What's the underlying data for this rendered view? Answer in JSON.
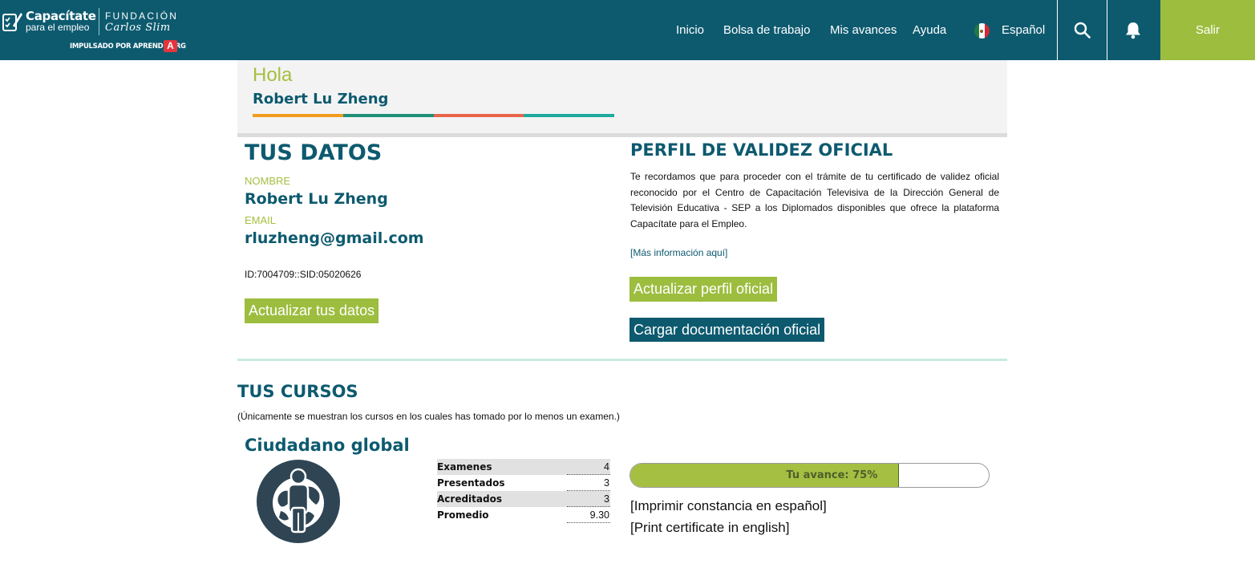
{
  "header": {
    "logo": {
      "brand": "Capacítate",
      "sub": "para el empleo",
      "fundacion": "FUNDACIÓN",
      "carlos_slim": "Carlos Slim",
      "impulsado": "IMPULSADO POR APRENDE.ORG",
      "a_badge": "A"
    },
    "nav": {
      "inicio": "Inicio",
      "bolsa": "Bolsa de trabajo",
      "avances": "Mis avances",
      "ayuda": "Ayuda",
      "language": "Español"
    },
    "salir": "Salir",
    "colors": {
      "bar": "#0d5a6f",
      "accent": "#9dbd3f"
    }
  },
  "greeting": {
    "hola": "Hola",
    "name": "Robert Lu Zheng",
    "bar_colors": [
      "#f39c1f",
      "#1f8f7a",
      "#e8664a",
      "#1eaaa0"
    ]
  },
  "tus_datos": {
    "title": "TUS DATOS",
    "nombre_label": "NOMBRE",
    "nombre": "Robert Lu Zheng",
    "email_label": "EMAIL",
    "email": "rluzheng@gmail.com",
    "id_text": "ID:7004709::SID:05020626",
    "update_button": "Actualizar tus datos"
  },
  "perfil": {
    "title": "PERFIL DE VALIDEZ OFICIAL",
    "paragraph": "Te recordamos que para proceder con el trámite de tu certificado de validez oficial reconocido por el Centro de Capacitación Televisiva de la Dirección General de Televisión Educativa - SEP a los Diplomados disponibles que ofrece la plataforma Capacítate para el Empleo.",
    "more_info": "[Más información aquí]",
    "update_button": "Actualizar perfil oficial",
    "upload_button": "Cargar documentación oficial"
  },
  "cursos": {
    "title": "TUS CURSOS",
    "note": "(Únicamente se muestran los cursos en los cuales has tomado por lo menos un examen.)",
    "items": [
      {
        "title": "Ciudadano global",
        "icon": "global-citizen-icon",
        "stats": [
          {
            "label": "Examenes",
            "value": "4"
          },
          {
            "label": "Presentados",
            "value": "3"
          },
          {
            "label": "Acreditados",
            "value": "3"
          },
          {
            "label": "Promedio",
            "value": "9.30"
          }
        ],
        "progress_label": "Tu avance: 75%",
        "progress": 0.75,
        "print_es": "[Imprimir constancia en español]",
        "print_en": "[Print certificate in english]"
      }
    ]
  }
}
